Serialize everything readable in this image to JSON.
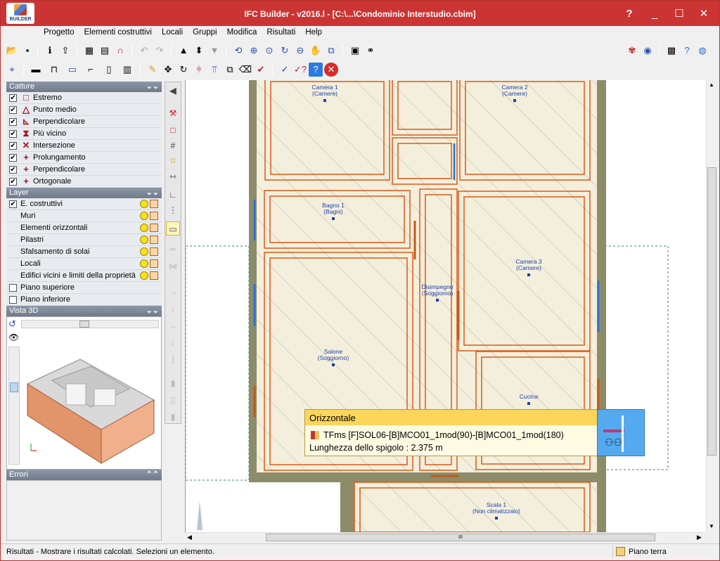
{
  "window": {
    "title": "IFC Builder - v2016.l - [C:\\...\\Condominio Interstudio.cbim]",
    "logo_text": "BUILDER",
    "help": "?",
    "minimize": "_",
    "maximize": "☐",
    "close": "✕"
  },
  "menu": [
    "Progetto",
    "Elementi costruttivi",
    "Locali",
    "Gruppi",
    "Modifica",
    "Risultati",
    "Help"
  ],
  "catture": {
    "title": "Catture",
    "items": [
      {
        "label": "Estremo",
        "symbol": "□",
        "checked": true
      },
      {
        "label": "Punto medio",
        "symbol": "△",
        "checked": true
      },
      {
        "label": "Perpendicolare",
        "symbol": "⊾",
        "checked": true
      },
      {
        "label": "Più vicino",
        "symbol": "⧗",
        "checked": true
      },
      {
        "label": "Intersezione",
        "symbol": "✕",
        "checked": true
      },
      {
        "label": "Prolungamento",
        "symbol": "+",
        "checked": true
      },
      {
        "label": "Perpendicolare",
        "symbol": "+",
        "checked": true
      },
      {
        "label": "Ortogonale",
        "symbol": "+",
        "checked": true
      }
    ]
  },
  "layer": {
    "title": "Layer",
    "items": [
      {
        "label": "E. costruttivi",
        "check": true,
        "checked": true
      },
      {
        "label": "Muri",
        "check": false
      },
      {
        "label": "Elementi orizzontali",
        "check": false
      },
      {
        "label": "Pilastri",
        "check": false
      },
      {
        "label": "Sfalsamento di solai",
        "check": false
      },
      {
        "label": "Locali",
        "check": false
      },
      {
        "label": "Edifici vicini e limiti della proprietà",
        "check": false
      }
    ],
    "plain": [
      {
        "label": "Piano superiore",
        "checked": false
      },
      {
        "label": "Piano inferiore",
        "checked": false
      }
    ]
  },
  "vista3d": {
    "title": "Vista 3D"
  },
  "errori": {
    "title": "Errori"
  },
  "rooms": [
    {
      "name": "Camera 1",
      "type": "(Camere)"
    },
    {
      "name": "Camera 2",
      "type": "(Camere)"
    },
    {
      "name": "Bagno 1",
      "type": "(Bagni)"
    },
    {
      "name": "Camera 3",
      "type": "(Camere)"
    },
    {
      "name": "Disimpegno",
      "type": "(Soggiorno)"
    },
    {
      "name": "Salone",
      "type": "(Soggiorno)"
    },
    {
      "name": "Cucina",
      "type": ""
    },
    {
      "name": "Scala 1",
      "type": "(Non climatizzato)"
    }
  ],
  "tooltip": {
    "header": "Orizzontale",
    "line1": "TFms [F]SOL06-[B]MCO01_1mod(90)-[B]MCO01_1mod(180)",
    "line2": "Lunghezza dello spigolo : 2.375 m"
  },
  "hscroll": {
    "grip": "III"
  },
  "status": {
    "text": "Risultati - Mostrare i risultati calcolati.  Selezioni un elemento.",
    "floor": "Piano terra"
  },
  "colors": {
    "title_bar": "#cc3434",
    "wall": "#d95a17",
    "room_label": "#1b3fa8",
    "tooltip_header": "#fbd65a"
  }
}
